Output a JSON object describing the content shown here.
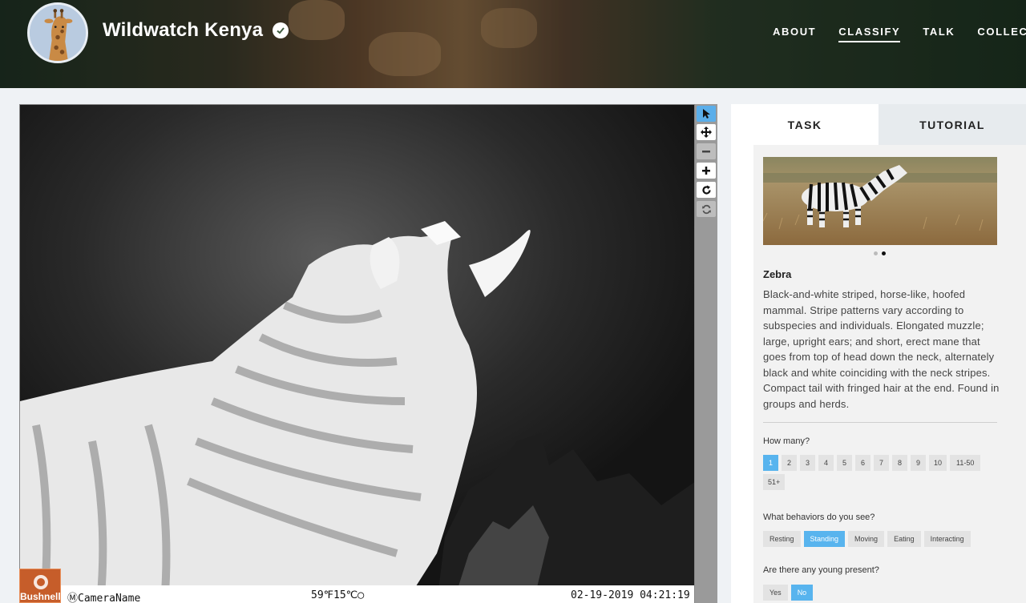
{
  "header": {
    "project_name": "Wildwatch Kenya",
    "nav": [
      {
        "label": "ABOUT",
        "active": false
      },
      {
        "label": "CLASSIFY",
        "active": true
      },
      {
        "label": "TALK",
        "active": false
      },
      {
        "label": "COLLECT",
        "active": false
      }
    ]
  },
  "camera": {
    "logo_text": "Bushnell",
    "name": "ⓂCameraName",
    "temp": "59℉15℃◯",
    "datetime": "02-19-2019 04:21:19"
  },
  "toolbar": {
    "tools": [
      "pointer-icon",
      "move-icon",
      "zoom-out-icon",
      "zoom-in-icon",
      "rotate-icon",
      "reset-icon"
    ]
  },
  "panel": {
    "tabs": [
      {
        "label": "TASK",
        "active": true
      },
      {
        "label": "TUTORIAL",
        "active": false
      }
    ],
    "species": {
      "name": "Zebra",
      "description": "Black-and-white striped, horse-like, hoofed mammal. Stripe patterns vary according to subspecies and individuals. Elongated muzzle; large, upright ears; and short, erect mane that goes from top of head down the neck, alternately black and white coinciding with the neck stripes. Compact tail with fringed hair at the end. Found in groups and herds."
    },
    "questions": {
      "how_many": {
        "label": "How many?",
        "options": [
          "1",
          "2",
          "3",
          "4",
          "5",
          "6",
          "7",
          "8",
          "9",
          "10",
          "11-50",
          "51+"
        ],
        "selected": "1"
      },
      "behaviors": {
        "label": "What behaviors do you see?",
        "options": [
          "Resting",
          "Standing",
          "Moving",
          "Eating",
          "Interacting"
        ],
        "selected": "Standing"
      },
      "young": {
        "label": "Are there any young present?",
        "options": [
          "Yes",
          "No"
        ],
        "selected": "No"
      }
    }
  },
  "colors": {
    "accent": "#58b4ee",
    "camera_logo": "#c65d2a"
  }
}
